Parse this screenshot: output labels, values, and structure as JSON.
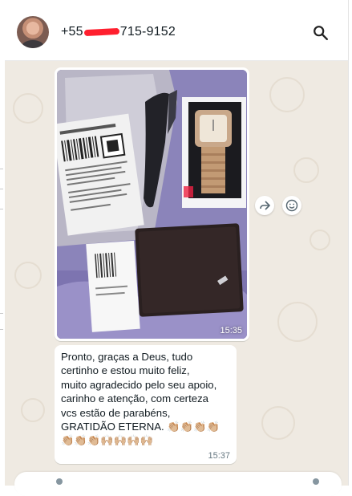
{
  "header": {
    "contact_prefix": "+55",
    "contact_suffix": "715-9152",
    "avatar_icon": "contact-avatar",
    "search_icon": "search-icon"
  },
  "messages": [
    {
      "type": "image",
      "time": "15:35",
      "actions": [
        "forward-icon",
        "emoji-icon"
      ]
    },
    {
      "type": "text",
      "text": "Pronto, graças a Deus, tudo\ncertinho e estou muito feliz,\nmuito agradecido pelo seu apoio,\ncarinho e atenção, com certeza\nvcs estão de parabéns,\nGRATIDÃO ETERNA. 👏🏼👏🏼👏🏼👏🏼\n👏🏼👏🏼👏🏼🙌🏼🙌🏼🙌🏼🙌🏼",
      "time": "15:37"
    }
  ],
  "colors": {
    "chat_background": "#efeae2",
    "bubble": "#ffffff",
    "redaction": "#ff1f2e",
    "text": "#111b21",
    "meta_text": "#667781"
  }
}
